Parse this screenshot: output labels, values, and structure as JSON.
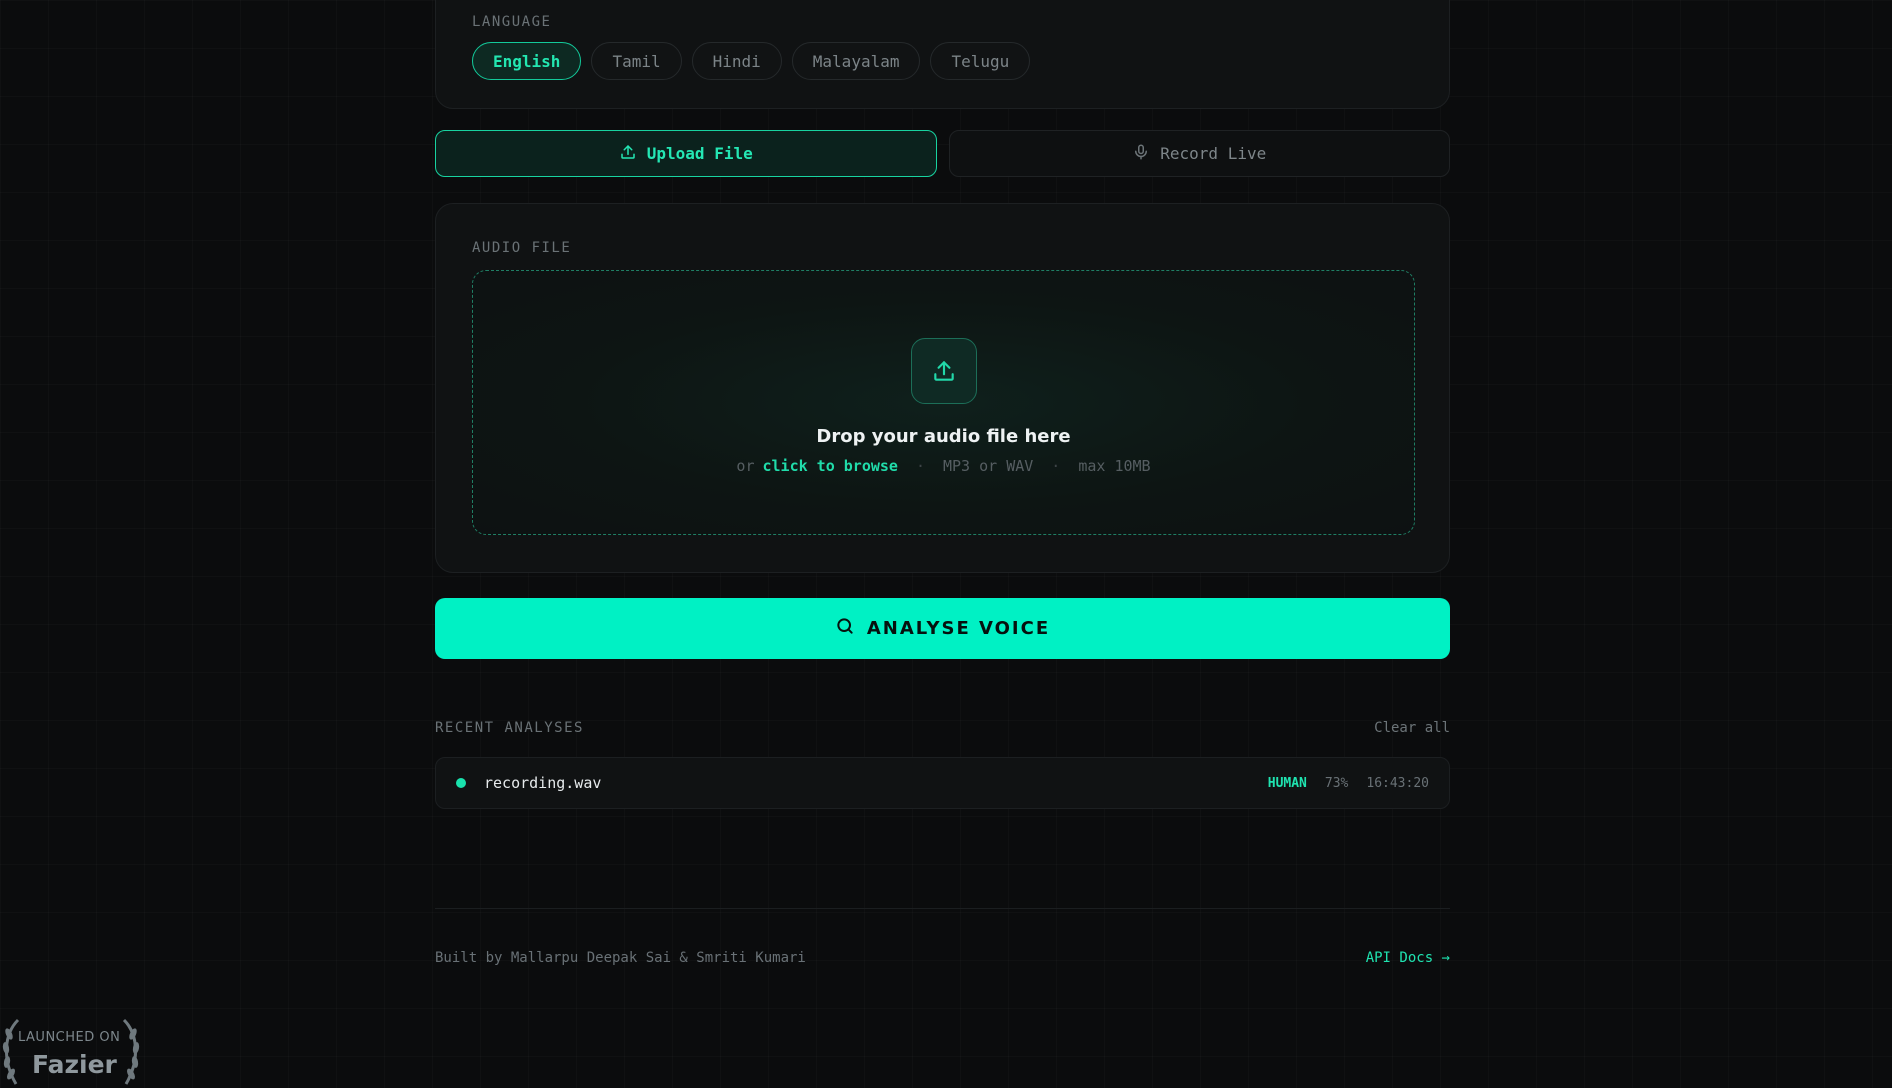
{
  "language": {
    "label": "LANGUAGE",
    "options": [
      "English",
      "Tamil",
      "Hindi",
      "Malayalam",
      "Telugu"
    ],
    "selected": "English"
  },
  "mode": {
    "upload": "Upload File",
    "record": "Record Live",
    "selected": "Upload File"
  },
  "audio": {
    "label": "AUDIO FILE",
    "title": "Drop your audio file here",
    "or": "or",
    "browse": "click to browse",
    "format": "MP3 or WAV",
    "max": "max 10MB",
    "separator": "·"
  },
  "analyse": {
    "label": "ANALYSE VOICE"
  },
  "recent": {
    "label": "RECENT ANALYSES",
    "clear": "Clear all",
    "items": [
      {
        "file": "recording.wav",
        "verdict": "HUMAN",
        "score": "73%",
        "time": "16:43:20"
      }
    ]
  },
  "footer": {
    "credits": "Built by Mallarpu Deepak Sai & Smriti Kumari",
    "api": "API Docs →"
  },
  "badge": {
    "small": "LAUNCHED ON",
    "big": "Fazier"
  },
  "colors": {
    "accent": "#00f1c4",
    "background": "#0b0c0d"
  }
}
